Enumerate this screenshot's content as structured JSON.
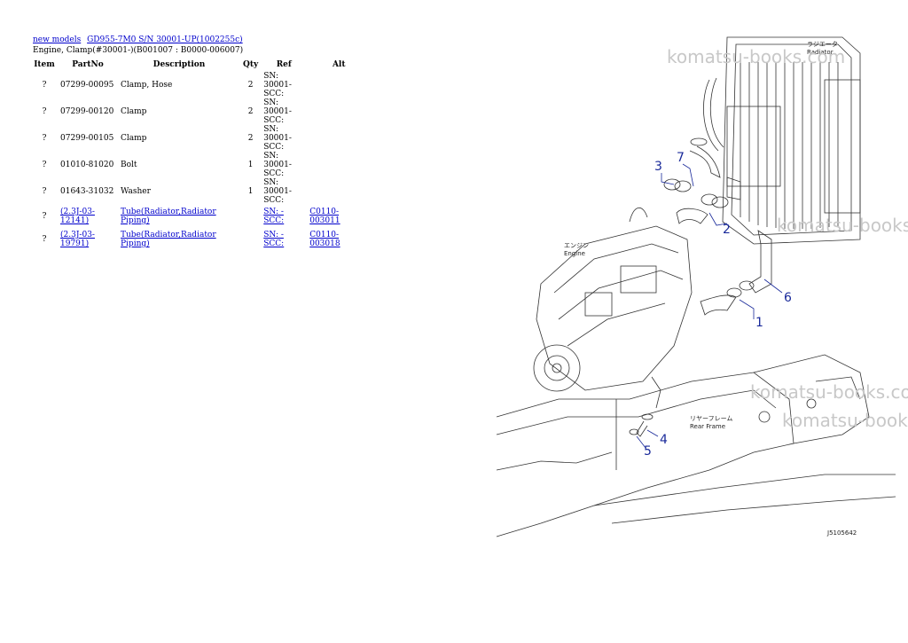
{
  "breadcrumb": {
    "link1": "new models",
    "link2": "GD955-7M0 S/N 30001-UP(1002255c)"
  },
  "subtitle": "Engine, Clamp(#30001-)(B001007 : B0000-006007)",
  "table": {
    "headers": {
      "item": "Item",
      "partno": "PartNo",
      "desc": "Description",
      "qty": "Qty",
      "ref": "Ref",
      "alt": "Alt"
    },
    "rows": [
      {
        "item": "?",
        "partno": "07299-00095",
        "desc": "Clamp, Hose",
        "qty": "2",
        "ref1": "SN: 30001-",
        "ref2": "SCC:",
        "alt": ""
      },
      {
        "item": "?",
        "partno": "07299-00120",
        "desc": "Clamp",
        "qty": "2",
        "ref1": "SN: 30001-",
        "ref2": "SCC:",
        "alt": ""
      },
      {
        "item": "?",
        "partno": "07299-00105",
        "desc": "Clamp",
        "qty": "2",
        "ref1": "SN: 30001-",
        "ref2": "SCC:",
        "alt": ""
      },
      {
        "item": "?",
        "partno": "01010-81020",
        "desc": "Bolt",
        "qty": "1",
        "ref1": "SN: 30001-",
        "ref2": "SCC:",
        "alt": ""
      },
      {
        "item": "?",
        "partno": "01643-31032",
        "desc": "Washer",
        "qty": "1",
        "ref1": "SN: 30001-",
        "ref2": "SCC:",
        "alt": ""
      }
    ],
    "link_rows": [
      {
        "item": "?",
        "partno": "(2.3J-03-12141)",
        "desc": "Tube(Radiator,Radiator Piping)",
        "qty": "",
        "ref1": "SN: -",
        "ref2": "SCC:",
        "alt": "C0110-003011"
      },
      {
        "item": "?",
        "partno": "(2.3J-03-19791)",
        "desc": "Tube(Radiator,Radiator Piping)",
        "qty": "",
        "ref1": "SN: -",
        "ref2": "SCC:",
        "alt": "C0110-003018"
      }
    ]
  },
  "watermark": "komatsu-books.com",
  "diagram": {
    "callouts": [
      "1",
      "2",
      "3",
      "4",
      "5",
      "6",
      "7"
    ],
    "labels": {
      "radiator_jp": "ラジエータ",
      "radiator_en": "Radiator",
      "engine_jp": "エンジン",
      "engine_en": "Engine",
      "frame_jp": "リヤーフレーム",
      "frame_en": "Rear Frame",
      "code": "J5105642"
    }
  }
}
